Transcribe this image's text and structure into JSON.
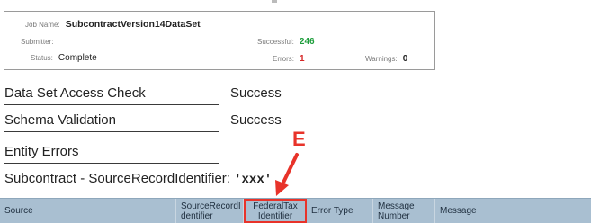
{
  "job": {
    "name_label": "Job Name:",
    "name_value": "SubcontractVersion14DataSet",
    "submitter_label": "Submitter:",
    "submitter_value": "",
    "status_label": "Status:",
    "status_value": "Complete",
    "successful_label": "Successful:",
    "successful_value": "246",
    "errors_label": "Errors:",
    "errors_value": "1",
    "warnings_label": "Warnings:",
    "warnings_value": "0"
  },
  "checks": [
    {
      "label": "Data Set Access Check",
      "value": "Success"
    },
    {
      "label": "Schema Validation",
      "value": "Success"
    }
  ],
  "entity_errors_label": "Entity Errors",
  "subheading": {
    "prefix": "Subcontract - SourceRecordIdentifier: ",
    "quoted": "'xxx'"
  },
  "callout_letter": "E",
  "table": {
    "columns": [
      "Source",
      "SourceRecordI dentifier",
      "FederalTax Identifier",
      "Error Type",
      "Message Number",
      "Message"
    ],
    "highlighted_column": "FederalTax Identifier"
  },
  "colors": {
    "header_bg": "#a9bfd1",
    "callout": "#e8332a",
    "success_count": "#1e9e3c",
    "error_count": "#d62828"
  }
}
